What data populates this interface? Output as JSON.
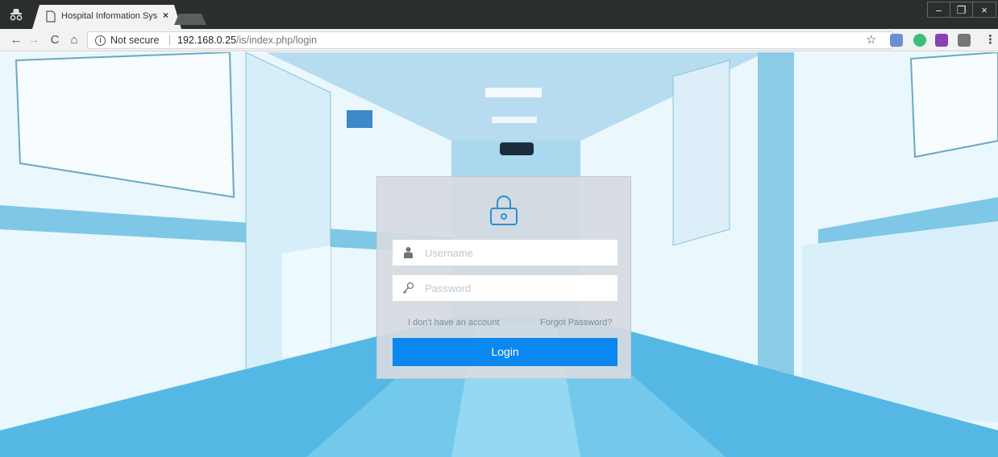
{
  "browser": {
    "tab": {
      "title": "Hospital Information Sys",
      "close_glyph": "×"
    },
    "window_controls": {
      "minimize": "–",
      "maximize": "❐",
      "close": "×"
    },
    "nav": {
      "back": "←",
      "forward": "→",
      "reload": "C",
      "home": "⌂"
    },
    "address": {
      "security_label": "Not secure",
      "url_host": "192.168.0.25",
      "url_path": "/is/index.php/login"
    },
    "bookmark_glyph": "☆",
    "menu_glyph": "⋮",
    "extensions": [
      "translate-icon",
      "grammarly-icon",
      "onenote-icon",
      "shield-icon"
    ]
  },
  "login": {
    "lock_icon": "lock-icon",
    "username": {
      "placeholder": "Username",
      "value": ""
    },
    "password": {
      "placeholder": "Password",
      "value": ""
    },
    "no_account_link": "I don't have an account",
    "forgot_link": "Forgot Password?",
    "submit_label": "Login"
  },
  "colors": {
    "accent": "#0a88f0",
    "lock_icon": "#2b8fd0",
    "panel": "#d5dae1"
  }
}
